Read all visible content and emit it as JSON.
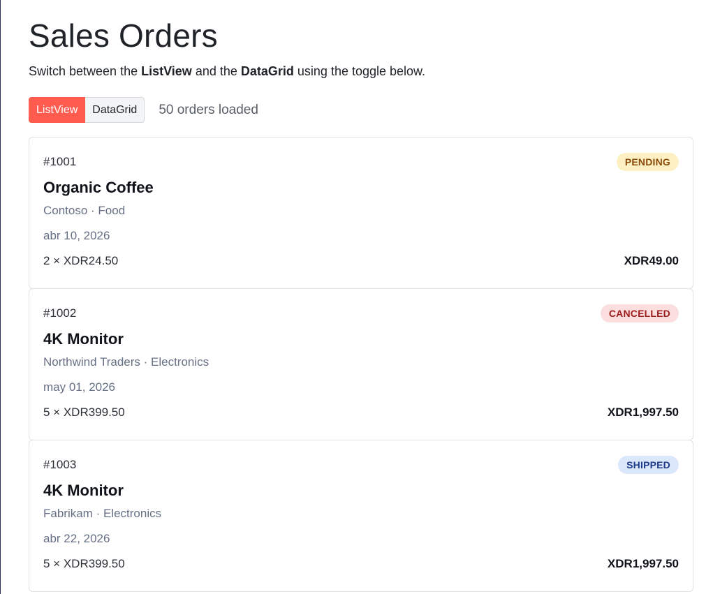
{
  "header": {
    "title": "Sales Orders",
    "intro_prefix": "Switch between the ",
    "intro_listview": "ListView",
    "intro_middle": " and the ",
    "intro_datagrid": "DataGrid",
    "intro_suffix": " using the toggle below."
  },
  "toolbar": {
    "listview_label": "ListView",
    "datagrid_label": "DataGrid",
    "active_view": "ListView",
    "count_text": "50 orders loaded"
  },
  "colors": {
    "accent": "#ff5b4f",
    "pending_bg": "#fdf1c4",
    "pending_fg": "#8a4b0b",
    "cancelled_bg": "#fcdede",
    "cancelled_fg": "#9b1c1c",
    "shipped_bg": "#dbe7fb",
    "shipped_fg": "#1e3a8a"
  },
  "orders": [
    {
      "id": "#1001",
      "status": "PENDING",
      "product": "Organic Coffee",
      "meta": "Contoso · Food",
      "date": "abr 10, 2026",
      "qty_price": "2 × XDR24.50",
      "total": "XDR49.00"
    },
    {
      "id": "#1002",
      "status": "CANCELLED",
      "product": "4K Monitor",
      "meta": "Northwind Traders · Electronics",
      "date": "may 01, 2026",
      "qty_price": "5 × XDR399.50",
      "total": "XDR1,997.50"
    },
    {
      "id": "#1003",
      "status": "SHIPPED",
      "product": "4K Monitor",
      "meta": "Fabrikam · Electronics",
      "date": "abr 22, 2026",
      "qty_price": "5 × XDR399.50",
      "total": "XDR1,997.50"
    }
  ]
}
